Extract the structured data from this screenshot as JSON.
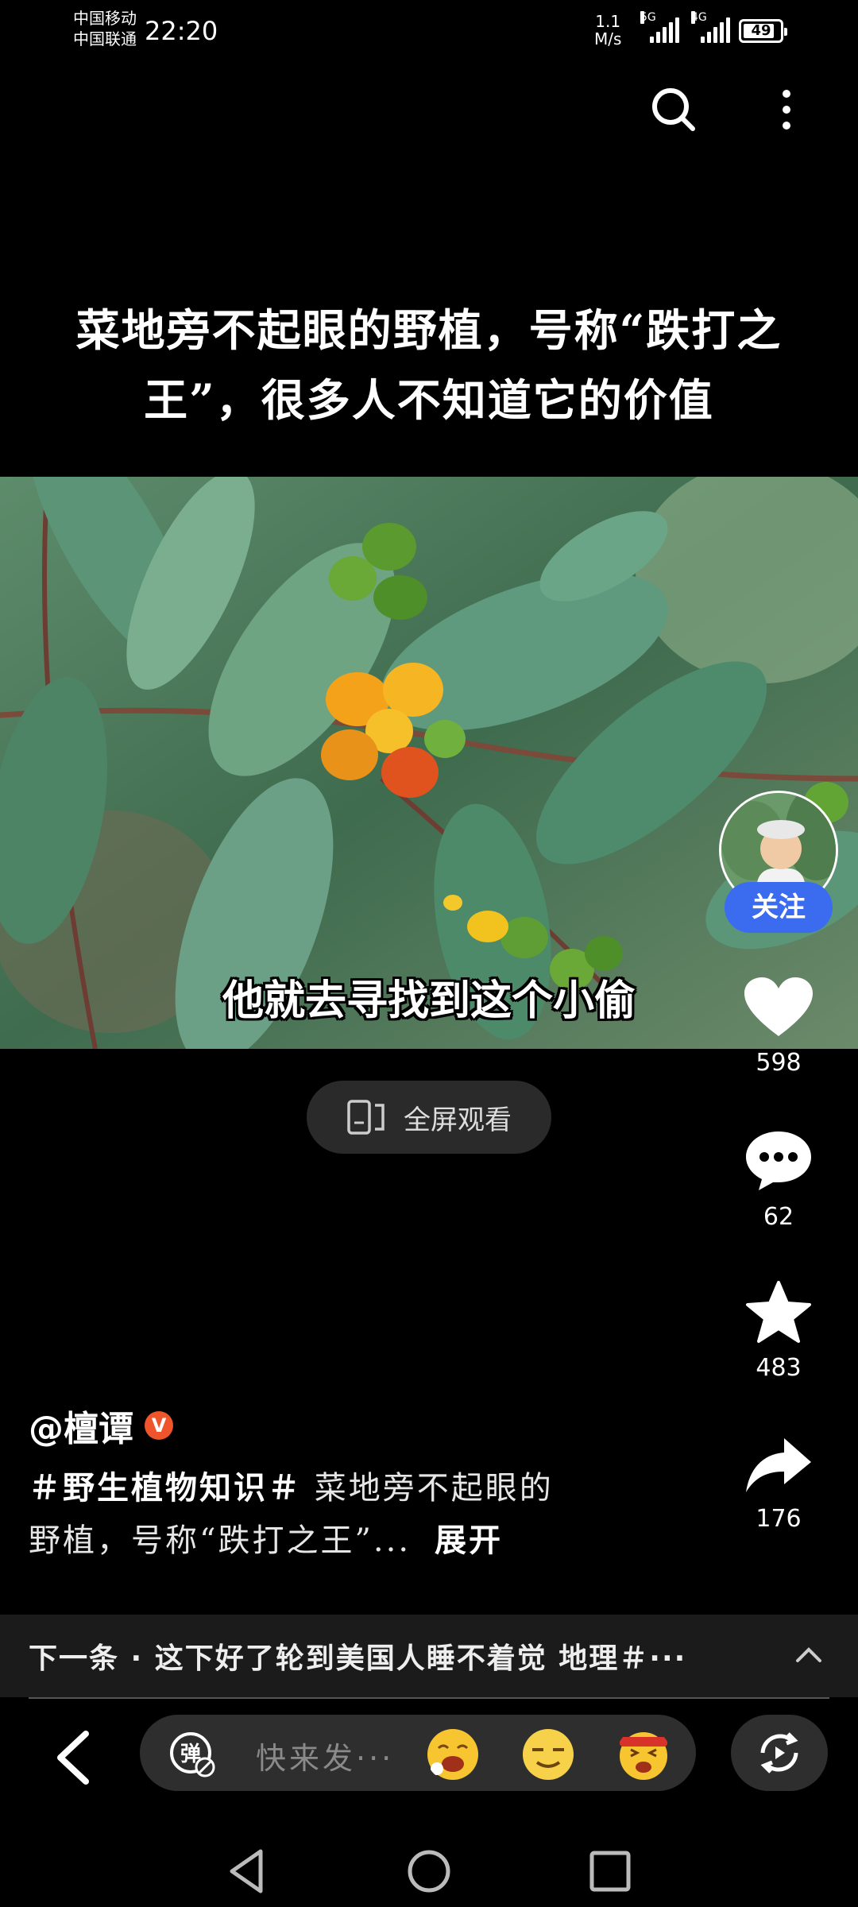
{
  "status_bar": {
    "carrier_1": "中国移动",
    "carrier_2": "中国联通",
    "time": "22:20",
    "net_speed_value": "1.1",
    "net_speed_unit": "M/s",
    "sig1_label": "5G",
    "sig2_label": "4G",
    "battery": "49"
  },
  "top_bar": {
    "search_icon": "search-icon",
    "more_icon": "more-vertical-icon"
  },
  "video": {
    "title_line1": "菜地旁不起眼的野植，号称“跌打之",
    "title_line2": "王”，很多人不知道它的价值",
    "subtitle": "他就去寻找到这个小偷",
    "fullscreen_label": "全屏观看"
  },
  "rail": {
    "follow_label": "关注",
    "likes": "598",
    "comments": "62",
    "favorites": "483",
    "shares": "176"
  },
  "post": {
    "author": "@檀谭",
    "author_badge": "V",
    "hashtag": "＃野生植物知识＃",
    "desc_1": " 菜地旁不起眼的",
    "desc_2": "野植，号称“跌打之王”...",
    "expand_label": "展开"
  },
  "next": {
    "label": "下一条 · 这下好了轮到美国人睡不着觉 地理＃···"
  },
  "bottom_bar": {
    "danmu_label": "弹",
    "input_placeholder": "快来发···"
  },
  "colors": {
    "follow": "#3b6cf0",
    "badge": "#f0542b"
  }
}
